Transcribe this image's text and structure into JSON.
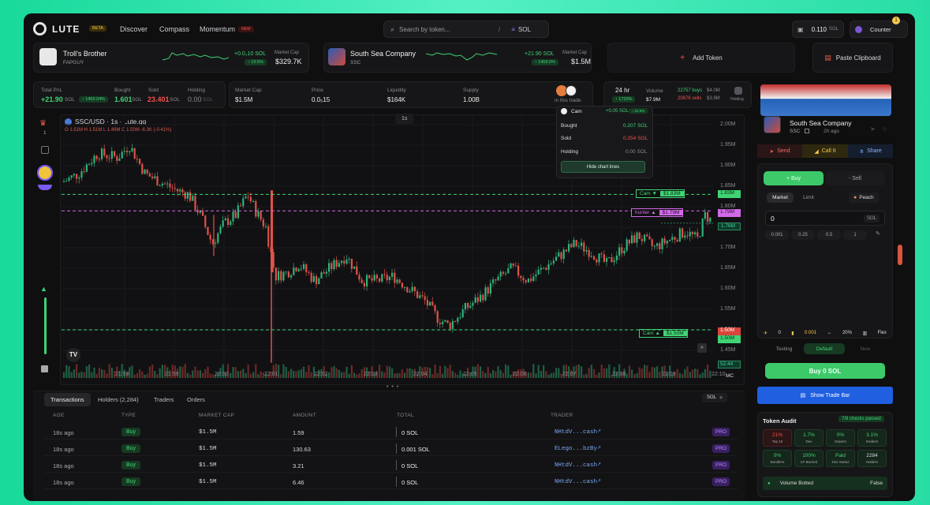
{
  "nav": {
    "logo": "LUTE",
    "beta": "BETA",
    "discover": "Discover",
    "compass": "Compass",
    "momentum": "Momentum",
    "new_badge": "NEW",
    "search_placeholder": "Search by token...",
    "search_key": "/",
    "chain": "SOL",
    "balance": "0.110",
    "balance_unit": "SOL",
    "user": "Counter",
    "notif_count": "1"
  },
  "tickers": [
    {
      "name": "Troll's Brother",
      "symbol": "FAPGUY",
      "change": "+0.0₂10 SOL",
      "pct": "↑ 19.5%",
      "mc_label": "Market Cap",
      "mc": "$329.7K",
      "color": "#3fd373"
    },
    {
      "name": "South Sea Company",
      "symbol": "SSC",
      "change": "+21.90 SOL",
      "pct": "↑ 1459.0%",
      "mc_label": "Market Cap",
      "mc": "$1.5M",
      "color": "#3fd373"
    }
  ],
  "add_token": "Add Token",
  "paste_clipboard": "Paste Clipboard",
  "stats": {
    "total_pnl_label": "Total PnL",
    "total_pnl": "+21.90",
    "total_pnl_unit": "SOL",
    "total_pnl_pct": "↑ 1459.04%",
    "bought_label": "Bought",
    "bought": "1.601",
    "bought_unit": "SOL",
    "sold_label": "Sold",
    "sold": "23.401",
    "sold_unit": "SOL",
    "holding_label": "Holding",
    "holding": "0.00",
    "holding_unit": "SOL",
    "mcap_label": "Market Cap",
    "mcap": "$1.5M",
    "price_label": "Price",
    "price": "0.0₅15",
    "liq_label": "Liquidity",
    "liq": "$164K",
    "supply_label": "Supply",
    "supply": "1.00B",
    "in_trade": "in this trade",
    "period": "24 hr",
    "period_pct": "↑ 1733%",
    "volume_label": "Volume",
    "volume": "$7.9M",
    "buys": "22757 buys",
    "buys_val": "$4.0M",
    "sells": "20876 sells",
    "sells_val": "$3.9M",
    "holding_btn": "Holding"
  },
  "chart": {
    "pair": "SSC/USD · 1s · Lute.gg",
    "ohlc": "O 1.51M  H 1.51M  L 1.49M  C 1.50M  -6.3K (-0.41%)",
    "interval": "1s",
    "yticks": [
      "2.00M",
      "1.95M",
      "1.90M",
      "1.85M",
      "1.80M",
      "1.75M",
      "1.70M",
      "1.65M",
      "1.60M",
      "1.55M",
      "1.50M",
      "1.45M"
    ],
    "xticks": [
      "21:58",
      "21:59",
      "22:00",
      "22:01",
      "22:02",
      "22:03",
      "22:04",
      "22:05",
      "22:06",
      "22:07",
      "22:08",
      "22:09",
      "22:10"
    ],
    "lines": [
      {
        "label": "Cam ▼",
        "value": "$1.83M",
        "axis": "1.83M",
        "color": "#3fd373"
      },
      {
        "label": "hunter ▲",
        "value": "$1.79M",
        "axis": "1.79M",
        "color": "#d16ae8"
      },
      {
        "label": "Cam ▲",
        "value": "$1.50M",
        "axis": "1.50M",
        "color": "#3fd373"
      }
    ],
    "last": "1.76M",
    "red_tag": "1.50M",
    "vol_tag": "52.44",
    "mc": "MC",
    "tooltip": {
      "user": "Cam",
      "pnl": "+0.05 SOL",
      "pnl_pct": "↑ 22.8%",
      "bought_label": "Bought",
      "bought": "0.207 SOL",
      "sold_label": "Sold",
      "sold": "0.254 SOL",
      "holding_label": "Holding",
      "holding": "0.00 SOL",
      "hide": "Hide chart lines"
    }
  },
  "bottom": {
    "tabs": [
      "Transactions",
      "Holders (2,284)",
      "Traders",
      "Orders"
    ],
    "unit": "SOL",
    "headers": [
      "AGE",
      "TYPE",
      "MARKET CAP",
      "AMOUNT",
      "TOTAL",
      "TRADER"
    ],
    "rows": [
      {
        "age": "18s ago",
        "type": "Buy",
        "mc": "$1.5M",
        "amount": "1.59",
        "total": "0 SOL",
        "trader": "NHtdV...cash",
        "tag": "PRO"
      },
      {
        "age": "18s ago",
        "type": "Buy",
        "mc": "$1.5M",
        "amount": "130.63",
        "total": "0.001 SOL",
        "trader": "ELego...bzBy",
        "tag": "PRO"
      },
      {
        "age": "18s ago",
        "type": "Buy",
        "mc": "$1.5M",
        "amount": "3.21",
        "total": "0 SOL",
        "trader": "NHtdV...cash",
        "tag": "PRO"
      },
      {
        "age": "18s ago",
        "type": "Buy",
        "mc": "$1.5M",
        "amount": "6.46",
        "total": "0 SOL",
        "trader": "NHtdV...cash",
        "tag": "PRO"
      }
    ]
  },
  "side": {
    "token_name": "South Sea Company",
    "token_symbol": "SSC",
    "token_age": "2h ago",
    "send": "Send",
    "call_it": "Call It",
    "share": "Share",
    "buy_tab": "+ Buy",
    "sell_tab": "- Sell",
    "market": "Market",
    "limit": "Limit",
    "peach": "Peach",
    "amount": "0",
    "amount_unit": "SOL",
    "presets": [
      "0.001",
      "0.25",
      "0.5",
      "1"
    ],
    "settings": [
      "0",
      "0.001",
      "20%",
      "Flex"
    ],
    "modes": [
      "Testing",
      "Default",
      "New"
    ],
    "buy_btn": "Buy 0 SOL",
    "trade_bar": "Show Trade Bar",
    "audit_title": "Token Audit",
    "audit_passed": "7/8 checks passed",
    "audit": [
      {
        "value": "21%",
        "label": "Top 10",
        "color": "#f0524a"
      },
      {
        "value": "1.7%",
        "label": "Dev",
        "color": "#3fd373"
      },
      {
        "value": "0%",
        "label": "Snipers",
        "color": "#3fd373"
      },
      {
        "value": "3.1%",
        "label": "Insiders",
        "color": "#3fd373"
      },
      {
        "value": "0%",
        "label": "Bundlers",
        "color": "#3fd373"
      },
      {
        "value": "100%",
        "label": "LP Burned",
        "color": "#3fd373"
      },
      {
        "value": "Paid",
        "label": "Dex Status",
        "color": "#3fd373"
      },
      {
        "value": "2284",
        "label": "Holders",
        "color": "#d8d8dc"
      }
    ],
    "volume_botted": "Volume Botted",
    "volume_botted_val": "False"
  }
}
